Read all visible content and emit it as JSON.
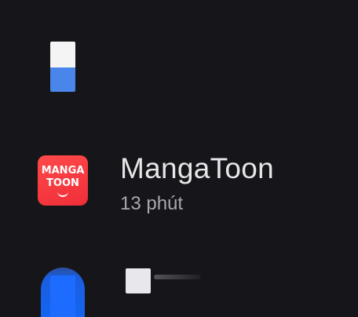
{
  "apps": [
    {
      "icon": "generic-app-icon",
      "colors": [
        "#f4f4f4",
        "#4a86ea"
      ]
    },
    {
      "name": "MangaToon",
      "usage_time": "13 phút",
      "icon": "mangatoon-logo-icon",
      "icon_text": [
        "MANGA",
        "TOON"
      ],
      "colors": [
        "#ef2e39",
        "#ffffff"
      ]
    },
    {
      "icon": "blue-app-icon",
      "colors": [
        "#1366f2"
      ]
    }
  ],
  "background_color": "#16161a"
}
